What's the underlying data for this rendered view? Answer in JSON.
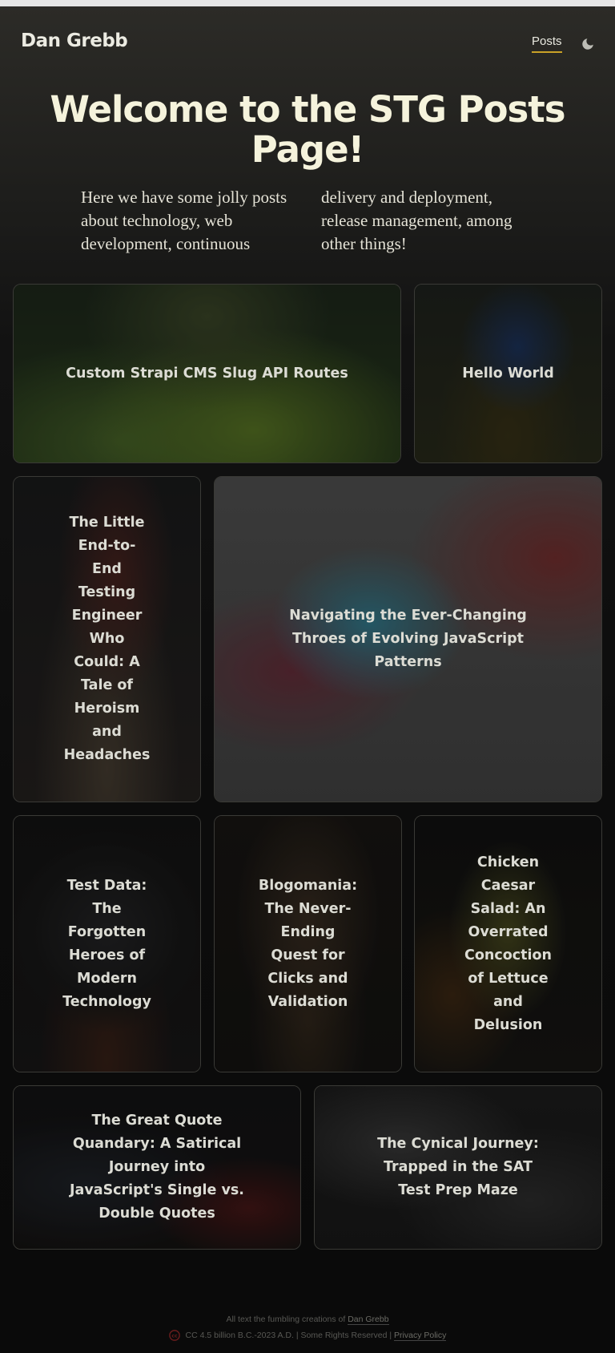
{
  "header": {
    "brand": "Dan Grebb",
    "nav": [
      {
        "label": "Posts",
        "active": true
      }
    ],
    "theme_toggle_icon": "moon-icon"
  },
  "hero": {
    "title": "Welcome to the STG Posts Page!",
    "description": "Here we have some jolly posts about technology, web development, continuous delivery and deployment, release management, among other things!"
  },
  "posts": [
    {
      "title": "Custom Strapi CMS Slug API Routes",
      "theme": "green garden, cat in grass"
    },
    {
      "title": "Hello World",
      "theme": "blue screen, olive tones"
    },
    {
      "title": "The Little End-to-End Testing Engineer Who Could: A Tale of Heroism and Headaches",
      "theme": "dark figure, warm glow"
    },
    {
      "title": "Navigating the Ever-Changing Throes of Evolving JavaScript Patterns",
      "theme": "red and blue wave on grey"
    },
    {
      "title": "Test Data: The Forgotten Heroes of Modern Technology",
      "theme": "dark circular machine"
    },
    {
      "title": "Blogomania: The Never-Ending Quest for Clicks and Validation",
      "theme": "warm brown crowd"
    },
    {
      "title": "Chicken Caesar Salad: An Overrated Concoction of Lettuce and Delusion",
      "theme": "salad greens on dark"
    },
    {
      "title": "The Great Quote Quandary: A Satirical Journey into JavaScript's Single vs. Double Quotes",
      "theme": "dark desk with red accent"
    },
    {
      "title": "The Cynical Journey: Trapped in the SAT Test Prep Maze",
      "theme": "grey maze"
    }
  ],
  "footer": {
    "line1_text": "All text the fumbling creations of",
    "line1_link": "Dan Grebb",
    "line2_text": "CC 4.5 billion B.C.-2023 A.D. | Some Rights Reserved |",
    "line2_link": "Privacy Policy",
    "license_icon": "creative-commons-icon"
  },
  "colors": {
    "accent_underline": "#c9a227",
    "title": "#f5f3dc",
    "background": "#0c0c0c"
  }
}
